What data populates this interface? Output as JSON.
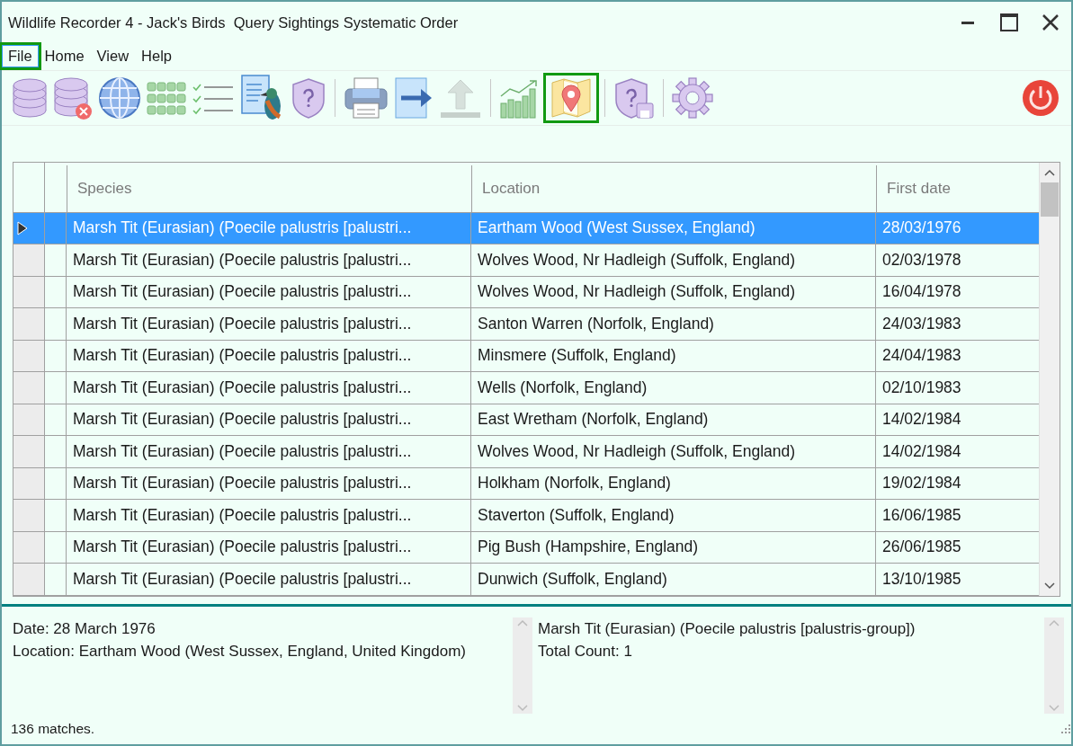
{
  "window": {
    "title": "Wildlife Recorder 4 - Jack's Birds  Query Sightings Systematic Order"
  },
  "menu": [
    {
      "label": "File",
      "highlighted": true
    },
    {
      "label": "Home",
      "highlighted": false
    },
    {
      "label": "View",
      "highlighted": false
    },
    {
      "label": "Help",
      "highlighted": false
    }
  ],
  "toolbar": [
    {
      "kind": "database",
      "highlighted": false,
      "disabled": false
    },
    {
      "kind": "database-close",
      "highlighted": false,
      "disabled": false
    },
    {
      "kind": "globe",
      "highlighted": false,
      "disabled": false
    },
    {
      "kind": "grid",
      "highlighted": false,
      "disabled": false
    },
    {
      "kind": "checklist",
      "highlighted": false,
      "disabled": false
    },
    {
      "kind": "document-bird",
      "highlighted": false,
      "disabled": false
    },
    {
      "kind": "shield-question",
      "highlighted": false,
      "disabled": false
    },
    {
      "kind": "separator"
    },
    {
      "kind": "printer",
      "highlighted": false,
      "disabled": false
    },
    {
      "kind": "export",
      "highlighted": false,
      "disabled": false
    },
    {
      "kind": "upload",
      "highlighted": false,
      "disabled": true
    },
    {
      "kind": "separator"
    },
    {
      "kind": "chart",
      "highlighted": false,
      "disabled": false
    },
    {
      "kind": "map",
      "highlighted": true,
      "disabled": false
    },
    {
      "kind": "separator"
    },
    {
      "kind": "shield-save",
      "highlighted": false,
      "disabled": false
    },
    {
      "kind": "separator"
    },
    {
      "kind": "gear",
      "highlighted": false,
      "disabled": false
    },
    {
      "kind": "spacer"
    },
    {
      "kind": "power",
      "highlighted": false,
      "disabled": false
    }
  ],
  "table": {
    "columns": [
      "Species",
      "Location",
      "First date"
    ],
    "rows": [
      {
        "selected": true,
        "cells": [
          "Marsh Tit (Eurasian) (Poecile palustris [palustri...",
          "Eartham Wood (West Sussex, England)",
          "28/03/1976"
        ]
      },
      {
        "selected": false,
        "cells": [
          "Marsh Tit (Eurasian) (Poecile palustris [palustri...",
          "Wolves Wood, Nr Hadleigh (Suffolk, England)",
          "02/03/1978"
        ]
      },
      {
        "selected": false,
        "cells": [
          "Marsh Tit (Eurasian) (Poecile palustris [palustri...",
          "Wolves Wood, Nr Hadleigh (Suffolk, England)",
          "16/04/1978"
        ]
      },
      {
        "selected": false,
        "cells": [
          "Marsh Tit (Eurasian) (Poecile palustris [palustri...",
          "Santon Warren (Norfolk, England)",
          "24/03/1983"
        ]
      },
      {
        "selected": false,
        "cells": [
          "Marsh Tit (Eurasian) (Poecile palustris [palustri...",
          "Minsmere (Suffolk, England)",
          "24/04/1983"
        ]
      },
      {
        "selected": false,
        "cells": [
          "Marsh Tit (Eurasian) (Poecile palustris [palustri...",
          "Wells (Norfolk, England)",
          "02/10/1983"
        ]
      },
      {
        "selected": false,
        "cells": [
          "Marsh Tit (Eurasian) (Poecile palustris [palustri...",
          "East Wretham (Norfolk, England)",
          "14/02/1984"
        ]
      },
      {
        "selected": false,
        "cells": [
          "Marsh Tit (Eurasian) (Poecile palustris [palustri...",
          "Wolves Wood, Nr Hadleigh (Suffolk, England)",
          "14/02/1984"
        ]
      },
      {
        "selected": false,
        "cells": [
          "Marsh Tit (Eurasian) (Poecile palustris [palustri...",
          "Holkham (Norfolk, England)",
          "19/02/1984"
        ]
      },
      {
        "selected": false,
        "cells": [
          "Marsh Tit (Eurasian) (Poecile palustris [palustri...",
          "Staverton (Suffolk, England)",
          "16/06/1985"
        ]
      },
      {
        "selected": false,
        "cells": [
          "Marsh Tit (Eurasian) (Poecile palustris [palustri...",
          "Pig Bush (Hampshire, England)",
          "26/06/1985"
        ]
      },
      {
        "selected": false,
        "cells": [
          "Marsh Tit (Eurasian) (Poecile palustris [palustri...",
          "Dunwich (Suffolk, England)",
          "13/10/1985"
        ]
      }
    ]
  },
  "details": {
    "left": [
      "Date: 28 March 1976",
      "Location: Eartham Wood (West Sussex, England, United Kingdom)"
    ],
    "right": [
      "Marsh Tit (Eurasian) (Poecile palustris [palustris-group])",
      "Total Count: 1"
    ]
  },
  "status_bar": {
    "text": "136 matches."
  }
}
